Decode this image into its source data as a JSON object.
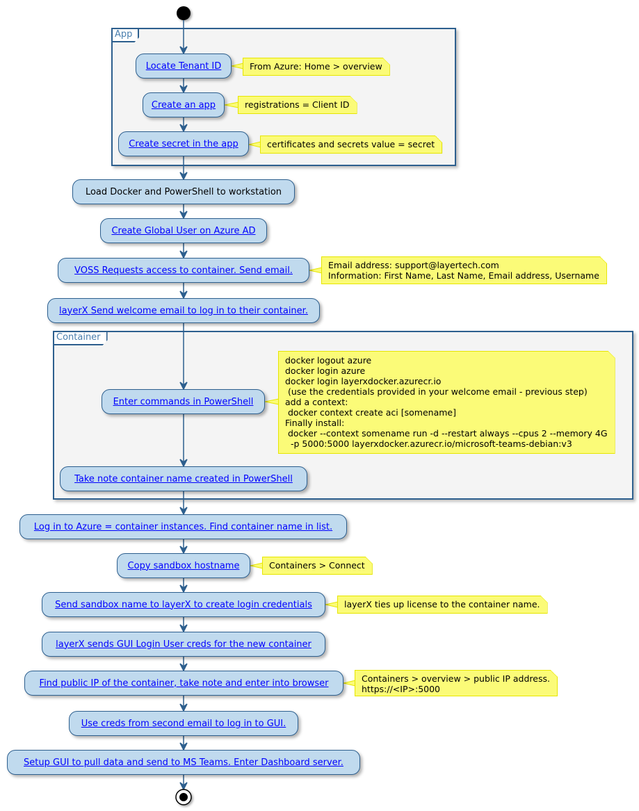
{
  "colors": {
    "node_fill": "#c0daee",
    "node_border": "#2d5f8e",
    "link_text": "#0000ff",
    "note_fill": "#fbfb78",
    "note_border": "#e6e600",
    "frame_fill": "#f4f4f4"
  },
  "frames": {
    "app": "App",
    "container": "Container"
  },
  "nodes": {
    "locate_tenant": "Locate Tenant ID",
    "create_app": "Create an app",
    "create_secret": "Create secret in the app",
    "load_docker": "Load Docker and PowerShell to workstation",
    "create_global_user": "Create Global User on Azure AD",
    "voss_requests": "VOSS Requests access to container.  Send email.",
    "layerx_welcome": "layerX Send welcome email to log in to their container.",
    "enter_commands": "Enter commands in PowerShell",
    "take_note": "Take note container name created in PowerShell",
    "login_azure": "Log in to Azure = container instances. Find container name in list.",
    "copy_hostname": "Copy sandbox hostname",
    "send_sandbox": "Send sandbox name to layerX to create login credentials",
    "layerx_gui_creds": "layerX sends GUI Login User creds for the new container",
    "find_public_ip": "Find public IP of the container, take note and enter into browser",
    "use_creds": "Use creds from second email to log in to GUI.",
    "setup_gui": "Setup GUI to pull data and send to MS Teams. Enter Dashboard server."
  },
  "notes": {
    "tenant": "From Azure: Home > overview",
    "app": "registrations = Client ID",
    "secret": "certificates and secrets value = secret",
    "voss": "Email address: support@layertech.com\nInformation: First Name, Last Name, Email address, Username",
    "commands": "docker logout azure\ndocker login azure\ndocker login layerxdocker.azurecr.io\n (use the credentials provided in your welcome email - previous step)\nadd a context:\n docker context create aci [somename]\nFinally install:\n docker --context somename run -d --restart always --cpus 2 --memory 4G\n  -p 5000:5000 layerxdocker.azurecr.io/microsoft-teams-debian:v3",
    "hostname": "Containers > Connect",
    "sandbox": "layerX ties up license to the container name.",
    "public_ip": "Containers > overview > public IP address.\nhttps://<IP>:5000"
  }
}
